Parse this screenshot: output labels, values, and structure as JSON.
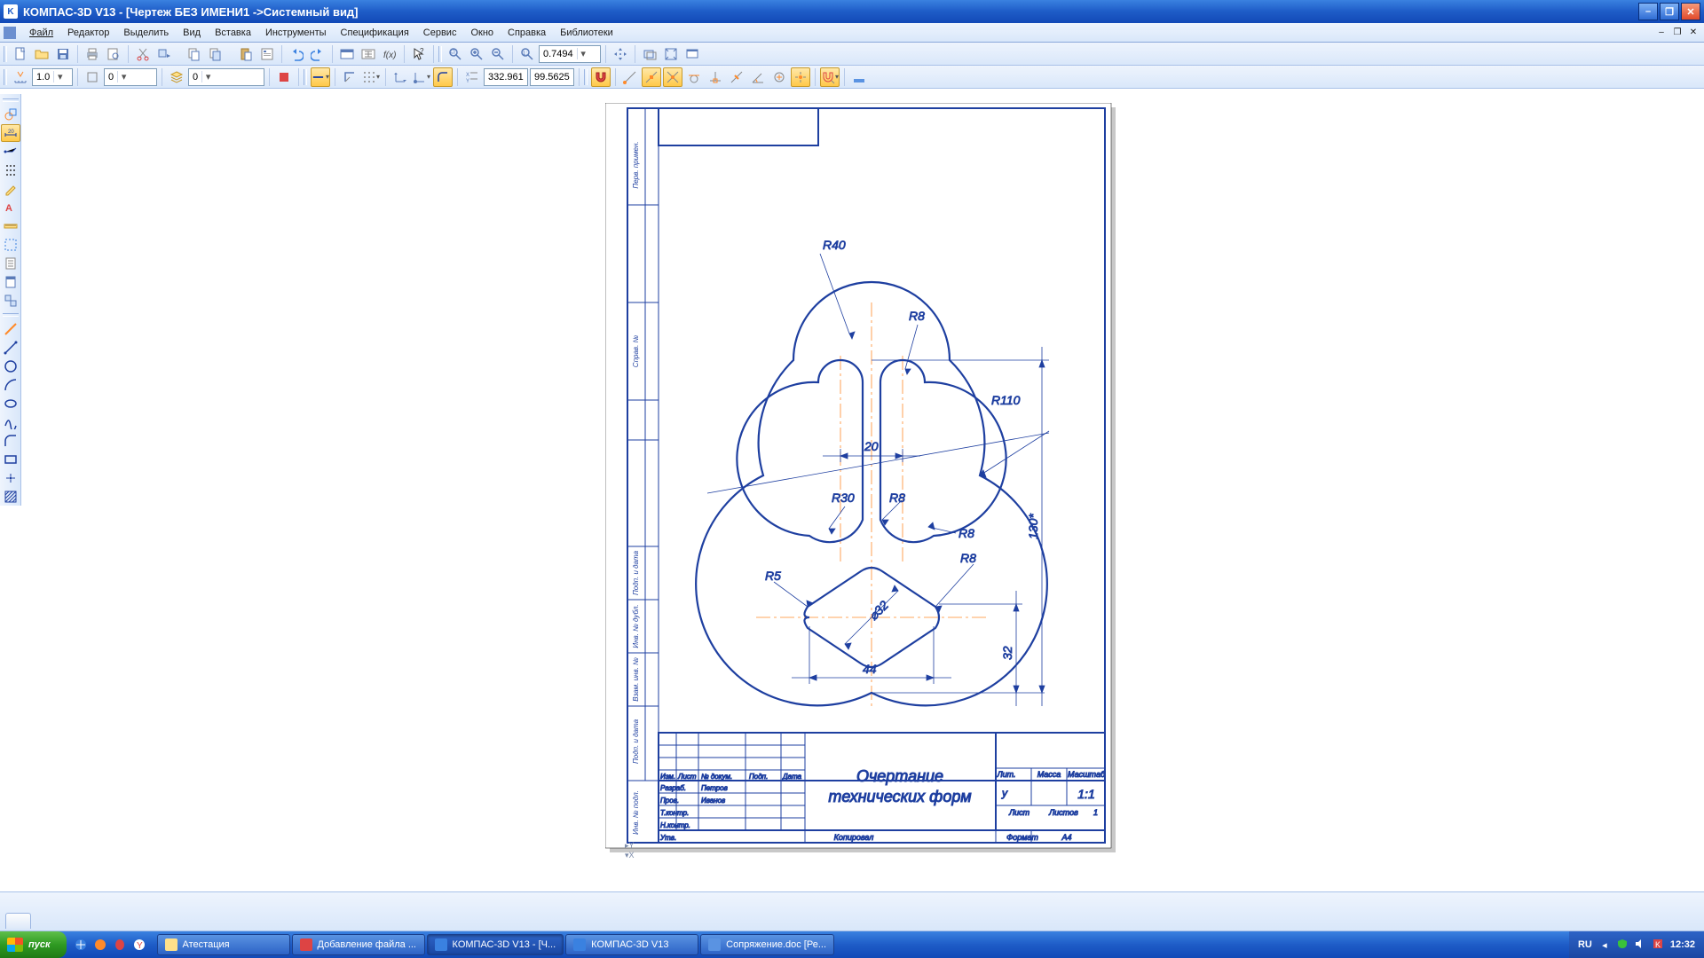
{
  "title": "КОМПАС-3D V13 - [Чертеж БЕЗ ИМЕНИ1 ->Системный вид]",
  "menus": [
    "Файл",
    "Редактор",
    "Выделить",
    "Вид",
    "Вставка",
    "Инструменты",
    "Спецификация",
    "Сервис",
    "Окно",
    "Справка",
    "Библиотеки"
  ],
  "toolbar1": {
    "zoom_value": "0.7494"
  },
  "toolbar2": {
    "step": "1.0",
    "val_a": "0",
    "val_b": "0",
    "coord_x": "332.961",
    "coord_y": "99.5625"
  },
  "drawing": {
    "dims": {
      "r40": "R40",
      "r8a": "R8",
      "r110": "R110",
      "dim20": "20",
      "r30": "R30",
      "r8b": "R8",
      "r8c": "R8",
      "r8d": "R8",
      "r5": "R5",
      "dia32": "⌀32",
      "dim44": "44",
      "dim32": "32",
      "dim130": "130*"
    },
    "stamp": {
      "title_l1": "Очертание",
      "title_l2": "технических форм",
      "col_izm": "Изм.",
      "col_list": "Лист",
      "col_ndoc": "№ докум.",
      "col_podp": "Подп.",
      "col_data": "Дата",
      "row_razrab": "Разраб.",
      "name_petrov": "Петров",
      "row_prov": "Пров.",
      "name_ivanov": "Иванов",
      "row_tkontr": "Т.контр.",
      "row_nkontr": "Н.контр.",
      "row_utv": "Утв.",
      "lit": "Лит.",
      "lit_val": "у",
      "massa": "Масса",
      "masshtab": "Масштаб",
      "scale": "1:1",
      "list": "Лист",
      "listov": "Листов",
      "listov_val": "1",
      "kopiroval": "Копировал",
      "format": "Формат",
      "format_val": "А4"
    },
    "side_labels": {
      "perv_primen": "Перв. примен.",
      "sprav_n": "Справ. №",
      "podp_data1": "Подп. и дата",
      "inv_dubl": "Инв. № дубл.",
      "vzam_inv": "Взам. инв. №",
      "podp_data2": "Подп. и дата",
      "inv_podl": "Инв. № подл."
    }
  },
  "taskbar": {
    "start": "пуск",
    "items": [
      {
        "label": "Атестация"
      },
      {
        "label": "Добавление файла ..."
      },
      {
        "label": "КОМПАС-3D V13 - [Ч...",
        "active": true
      },
      {
        "label": "КОМПАС-3D V13"
      },
      {
        "label": "Сопряжение.doc [Ре..."
      }
    ],
    "lang": "RU",
    "time": "12:32"
  }
}
